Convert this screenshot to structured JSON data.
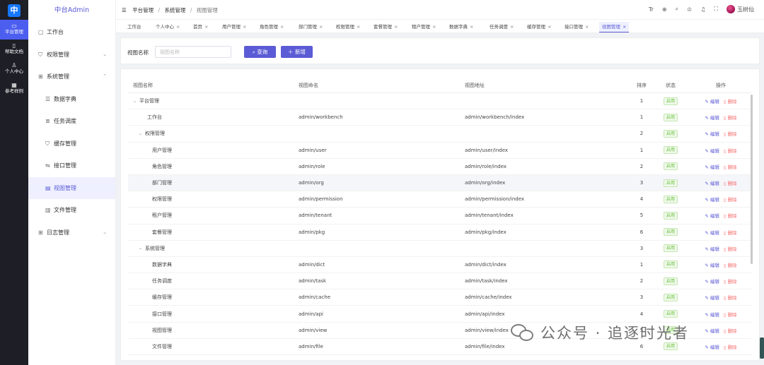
{
  "rail": {
    "logo": "中",
    "items": [
      {
        "icon": "monitor-icon",
        "glyph": "▭",
        "label": "平台管理",
        "active": true
      },
      {
        "icon": "book-icon",
        "glyph": "▯",
        "label": "帮助文档",
        "active": false
      },
      {
        "icon": "person-icon",
        "glyph": "♙",
        "label": "个人中心",
        "active": false
      },
      {
        "icon": "grid-icon",
        "glyph": "▦",
        "label": "参考样例",
        "active": false
      }
    ]
  },
  "sidebar": {
    "brand": "中台Admin",
    "items": [
      {
        "label": "工作台",
        "glyph": "▢",
        "icon": "monitor-icon",
        "sub": false,
        "chevron": "",
        "active": false
      },
      {
        "label": "权限管理",
        "glyph": "⛉",
        "icon": "shield-icon",
        "sub": false,
        "chevron": "⌄",
        "active": false
      },
      {
        "label": "系统管理",
        "glyph": "⊞",
        "icon": "windows-icon",
        "sub": false,
        "chevron": "⌃",
        "active": false
      },
      {
        "label": "数据字典",
        "glyph": "☰",
        "icon": "database-icon",
        "sub": true,
        "chevron": "",
        "active": false
      },
      {
        "label": "任务调度",
        "glyph": "≣",
        "icon": "list-icon",
        "sub": true,
        "chevron": "",
        "active": false
      },
      {
        "label": "缓存管理",
        "glyph": "⛉",
        "icon": "cache-icon",
        "sub": true,
        "chevron": "",
        "active": false
      },
      {
        "label": "接口管理",
        "glyph": "⇋",
        "icon": "api-icon",
        "sub": true,
        "chevron": "",
        "active": false
      },
      {
        "label": "视图管理",
        "glyph": "▤",
        "icon": "view-icon",
        "sub": true,
        "chevron": "",
        "active": true
      },
      {
        "label": "文件管理",
        "glyph": "▥",
        "icon": "file-icon",
        "sub": true,
        "chevron": "",
        "active": false
      },
      {
        "label": "日志管理",
        "glyph": "⊞",
        "icon": "log-icon",
        "sub": false,
        "chevron": "⌄",
        "active": false
      }
    ]
  },
  "header": {
    "crumbs": [
      "平台管理",
      "系统管理",
      "视图管理"
    ],
    "icons": [
      {
        "name": "translate-icon",
        "glyph": "Tr"
      },
      {
        "name": "globe-icon",
        "glyph": "⊕"
      },
      {
        "name": "search-icon",
        "glyph": "⌕"
      },
      {
        "name": "shirt-icon",
        "glyph": "♔"
      },
      {
        "name": "bell-icon",
        "glyph": "♫"
      },
      {
        "name": "fullscreen-icon",
        "glyph": "⛶"
      }
    ],
    "username": "玉树仙"
  },
  "tabs": [
    {
      "label": "工作台",
      "closable": false,
      "active": false
    },
    {
      "label": "个人中心",
      "closable": true,
      "active": false
    },
    {
      "label": "首页",
      "closable": true,
      "active": false
    },
    {
      "label": "用户管理",
      "closable": true,
      "active": false
    },
    {
      "label": "角色管理",
      "closable": true,
      "active": false
    },
    {
      "label": "部门管理",
      "closable": true,
      "active": false
    },
    {
      "label": "权限管理",
      "closable": true,
      "active": false
    },
    {
      "label": "套餐管理",
      "closable": true,
      "active": false
    },
    {
      "label": "租户管理",
      "closable": true,
      "active": false
    },
    {
      "label": "数据字典",
      "closable": true,
      "active": false
    },
    {
      "label": "任务调度",
      "closable": true,
      "active": false
    },
    {
      "label": "缓存管理",
      "closable": true,
      "active": false
    },
    {
      "label": "接口管理",
      "closable": true,
      "active": false
    },
    {
      "label": "视图管理",
      "closable": true,
      "active": true
    }
  ],
  "search": {
    "label": "视图名称",
    "placeholder": "视图名称",
    "query_label": "查询",
    "add_label": "新增"
  },
  "table": {
    "columns": {
      "name": "视图名称",
      "code": "视图命名",
      "path": "视图地址",
      "sort": "排序",
      "status": "状态",
      "ops": "操作"
    },
    "edit_label": "编辑",
    "delete_label": "删除",
    "rows": [
      {
        "name": "平台管理",
        "level": 0,
        "expandable": true,
        "code": "",
        "path": "",
        "sort": "1",
        "status": "启用",
        "highlight": false
      },
      {
        "name": "工作台",
        "level": 1,
        "expandable": false,
        "code": "admin/workbench",
        "path": "admin/workbench/index",
        "sort": "1",
        "status": "启用",
        "highlight": false
      },
      {
        "name": "权限管理",
        "level": 1,
        "expandable": true,
        "code": "",
        "path": "",
        "sort": "2",
        "status": "启用",
        "highlight": false
      },
      {
        "name": "用户管理",
        "level": 2,
        "expandable": false,
        "code": "admin/user",
        "path": "admin/user/index",
        "sort": "1",
        "status": "启用",
        "highlight": false
      },
      {
        "name": "角色管理",
        "level": 2,
        "expandable": false,
        "code": "admin/role",
        "path": "admin/role/index",
        "sort": "2",
        "status": "启用",
        "highlight": false
      },
      {
        "name": "部门管理",
        "level": 2,
        "expandable": false,
        "code": "admin/org",
        "path": "admin/org/index",
        "sort": "3",
        "status": "启用",
        "highlight": true
      },
      {
        "name": "权限管理",
        "level": 2,
        "expandable": false,
        "code": "admin/permission",
        "path": "admin/permission/index",
        "sort": "4",
        "status": "启用",
        "highlight": false
      },
      {
        "name": "租户管理",
        "level": 2,
        "expandable": false,
        "code": "admin/tenant",
        "path": "admin/tenant/index",
        "sort": "5",
        "status": "启用",
        "highlight": false
      },
      {
        "name": "套餐管理",
        "level": 2,
        "expandable": false,
        "code": "admin/pkg",
        "path": "admin/pkg/index",
        "sort": "6",
        "status": "启用",
        "highlight": false
      },
      {
        "name": "系统管理",
        "level": 1,
        "expandable": true,
        "code": "",
        "path": "",
        "sort": "3",
        "status": "启用",
        "highlight": false
      },
      {
        "name": "数据字典",
        "level": 2,
        "expandable": false,
        "code": "admin/dict",
        "path": "admin/dict/index",
        "sort": "1",
        "status": "启用",
        "highlight": false
      },
      {
        "name": "任务调度",
        "level": 2,
        "expandable": false,
        "code": "admin/task",
        "path": "admin/task/index",
        "sort": "2",
        "status": "启用",
        "highlight": false
      },
      {
        "name": "缓存管理",
        "level": 2,
        "expandable": false,
        "code": "admin/cache",
        "path": "admin/cache/index",
        "sort": "3",
        "status": "启用",
        "highlight": false
      },
      {
        "name": "接口管理",
        "level": 2,
        "expandable": false,
        "code": "admin/api",
        "path": "admin/api/index",
        "sort": "4",
        "status": "启用",
        "highlight": false
      },
      {
        "name": "视图管理",
        "level": 2,
        "expandable": false,
        "code": "admin/view",
        "path": "admin/view/index",
        "sort": "5",
        "status": "启用",
        "highlight": false
      },
      {
        "name": "文件管理",
        "level": 2,
        "expandable": false,
        "code": "admin/file",
        "path": "admin/file/index",
        "sort": "6",
        "status": "启用",
        "highlight": false
      }
    ]
  },
  "watermark": {
    "text": "公众号 · 追逐时光者"
  },
  "colors": {
    "primary": "#5b5bd6",
    "rail_bg": "#1d1e26",
    "rail_active": "#4c5ef0",
    "success": "#67c23a",
    "danger": "#f56c6c"
  }
}
